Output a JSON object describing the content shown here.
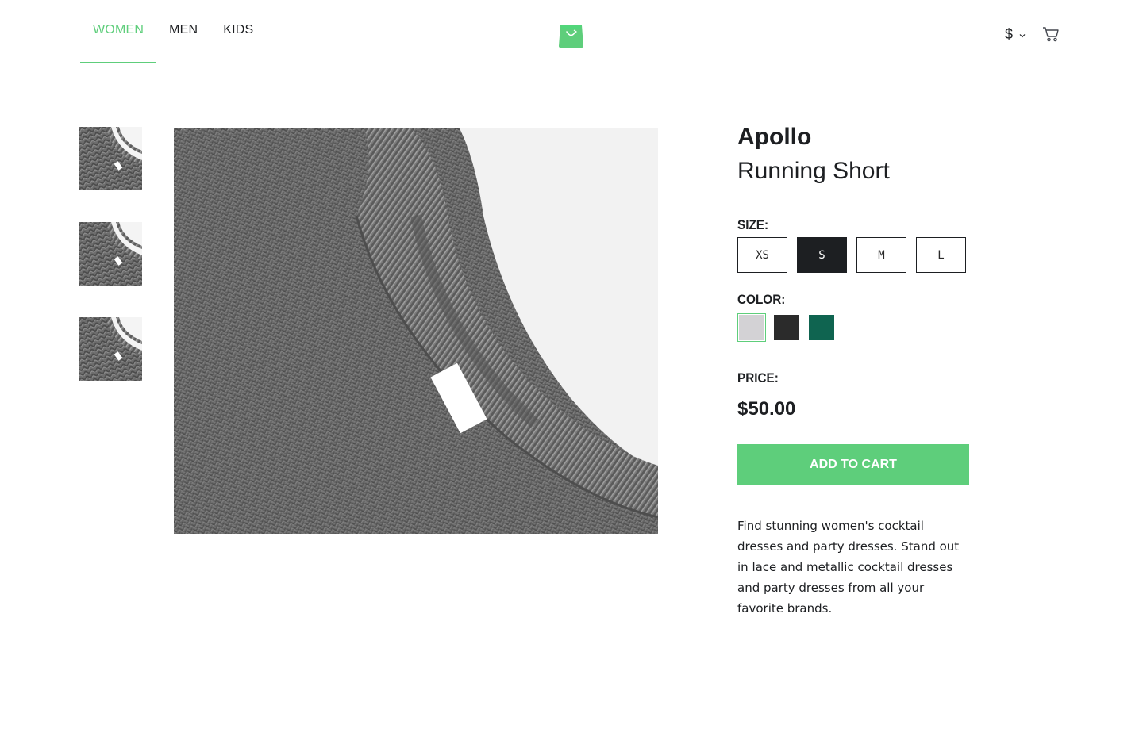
{
  "nav": {
    "items": [
      {
        "label": "WOMEN",
        "active": true
      },
      {
        "label": "MEN",
        "active": false
      },
      {
        "label": "KIDS",
        "active": false
      }
    ]
  },
  "header": {
    "logo_icon": "shopping-bag-icon",
    "currency_symbol": "$",
    "currency_icon": "chevron-down-icon",
    "cart_icon": "cart-icon"
  },
  "product": {
    "brand": "Apollo",
    "name": "Running Short",
    "size_label": "SIZE:",
    "sizes": [
      {
        "label": "XS",
        "selected": false
      },
      {
        "label": "S",
        "selected": true
      },
      {
        "label": "M",
        "selected": false
      },
      {
        "label": "L",
        "selected": false
      }
    ],
    "color_label": "COLOR:",
    "colors": [
      {
        "name": "light-gray",
        "hex": "#d3d2d5",
        "selected": true
      },
      {
        "name": "black",
        "hex": "#2b2b2b",
        "selected": false
      },
      {
        "name": "green",
        "hex": "#0f6450",
        "selected": false
      }
    ],
    "price_label": "PRICE:",
    "price": "$50.00",
    "add_to_cart": "ADD TO CART",
    "description": "Find stunning women's cocktail dresses and party dresses. Stand out in lace and metallic cocktail dresses and party dresses from all your favorite brands."
  },
  "colors": {
    "accent": "#5ece7b",
    "text": "#1d1f22"
  }
}
